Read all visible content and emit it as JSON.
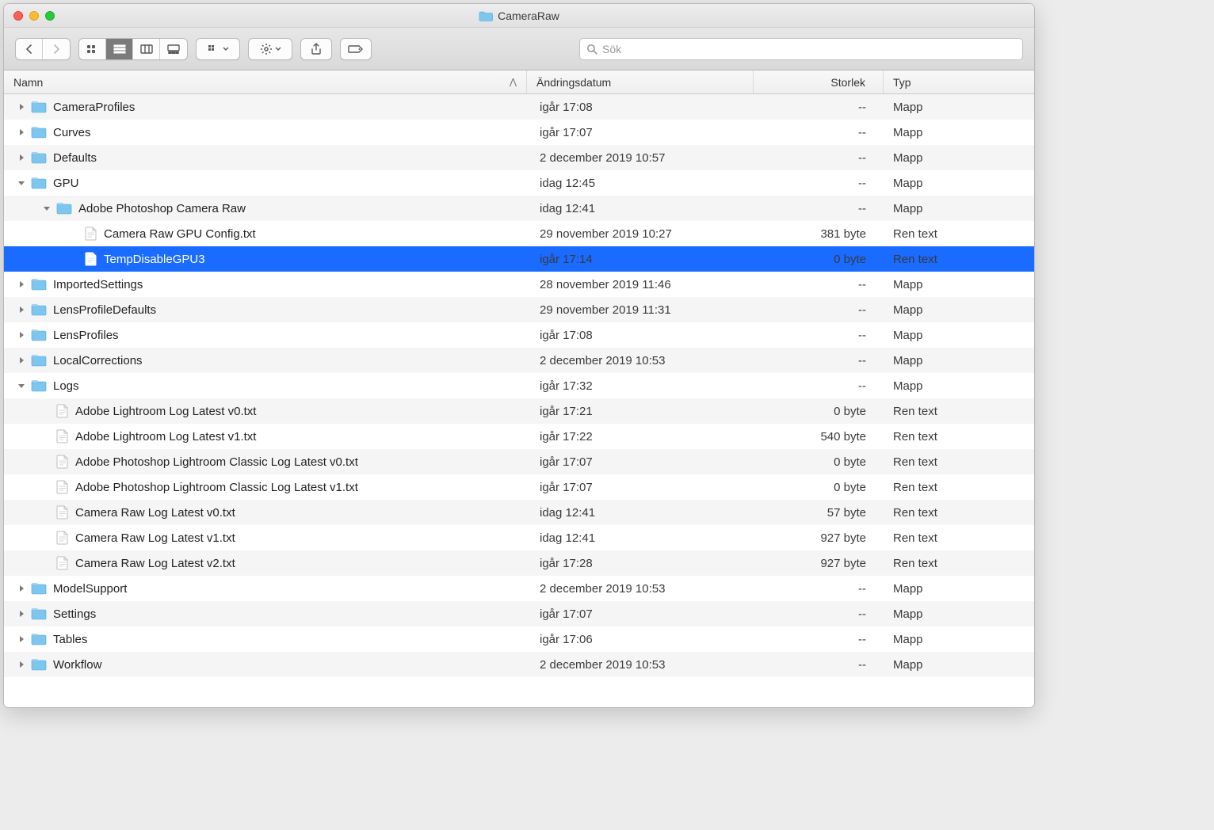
{
  "window": {
    "title": "CameraRaw"
  },
  "search": {
    "placeholder": "Sök"
  },
  "columns": {
    "name": "Namn",
    "date": "Ändringsdatum",
    "size": "Storlek",
    "type": "Typ"
  },
  "rows": [
    {
      "indent": 0,
      "kind": "folder",
      "disclosure": "closed",
      "name": "CameraProfiles",
      "date": "igår 17:08",
      "size": "--",
      "type": "Mapp",
      "alt": true
    },
    {
      "indent": 0,
      "kind": "folder",
      "disclosure": "closed",
      "name": "Curves",
      "date": "igår 17:07",
      "size": "--",
      "type": "Mapp",
      "alt": false
    },
    {
      "indent": 0,
      "kind": "folder",
      "disclosure": "closed",
      "name": "Defaults",
      "date": "2 december 2019 10:57",
      "size": "--",
      "type": "Mapp",
      "alt": true
    },
    {
      "indent": 0,
      "kind": "folder",
      "disclosure": "open",
      "name": "GPU",
      "date": "idag 12:45",
      "size": "--",
      "type": "Mapp",
      "alt": false
    },
    {
      "indent": 1,
      "kind": "folder",
      "disclosure": "open",
      "name": "Adobe Photoshop Camera Raw",
      "date": "idag 12:41",
      "size": "--",
      "type": "Mapp",
      "alt": true
    },
    {
      "indent": 2,
      "kind": "file",
      "disclosure": "none",
      "name": "Camera Raw GPU Config.txt",
      "date": "29 november 2019 10:27",
      "size": "381 byte",
      "type": "Ren text",
      "alt": false
    },
    {
      "indent": 2,
      "kind": "file",
      "disclosure": "none",
      "name": "TempDisableGPU3",
      "date": "igår 17:14",
      "size": "0 byte",
      "type": "Ren text",
      "alt": true,
      "selected": true
    },
    {
      "indent": 0,
      "kind": "folder",
      "disclosure": "closed",
      "name": "ImportedSettings",
      "date": "28 november 2019 11:46",
      "size": "--",
      "type": "Mapp",
      "alt": false
    },
    {
      "indent": 0,
      "kind": "folder",
      "disclosure": "closed",
      "name": "LensProfileDefaults",
      "date": "29 november 2019 11:31",
      "size": "--",
      "type": "Mapp",
      "alt": true
    },
    {
      "indent": 0,
      "kind": "folder",
      "disclosure": "closed",
      "name": "LensProfiles",
      "date": "igår 17:08",
      "size": "--",
      "type": "Mapp",
      "alt": false
    },
    {
      "indent": 0,
      "kind": "folder",
      "disclosure": "closed",
      "name": "LocalCorrections",
      "date": "2 december 2019 10:53",
      "size": "--",
      "type": "Mapp",
      "alt": true
    },
    {
      "indent": 0,
      "kind": "folder",
      "disclosure": "open",
      "name": "Logs",
      "date": "igår 17:32",
      "size": "--",
      "type": "Mapp",
      "alt": false
    },
    {
      "indent": 1,
      "kind": "file",
      "disclosure": "none",
      "name": "Adobe Lightroom Log Latest v0.txt",
      "date": "igår 17:21",
      "size": "0 byte",
      "type": "Ren text",
      "alt": true
    },
    {
      "indent": 1,
      "kind": "file",
      "disclosure": "none",
      "name": "Adobe Lightroom Log Latest v1.txt",
      "date": "igår 17:22",
      "size": "540 byte",
      "type": "Ren text",
      "alt": false
    },
    {
      "indent": 1,
      "kind": "file",
      "disclosure": "none",
      "name": "Adobe Photoshop Lightroom Classic Log Latest v0.txt",
      "date": "igår 17:07",
      "size": "0 byte",
      "type": "Ren text",
      "alt": true
    },
    {
      "indent": 1,
      "kind": "file",
      "disclosure": "none",
      "name": "Adobe Photoshop Lightroom Classic Log Latest v1.txt",
      "date": "igår 17:07",
      "size": "0 byte",
      "type": "Ren text",
      "alt": false
    },
    {
      "indent": 1,
      "kind": "file",
      "disclosure": "none",
      "name": "Camera Raw Log Latest v0.txt",
      "date": "idag 12:41",
      "size": "57 byte",
      "type": "Ren text",
      "alt": true
    },
    {
      "indent": 1,
      "kind": "file",
      "disclosure": "none",
      "name": "Camera Raw Log Latest v1.txt",
      "date": "idag 12:41",
      "size": "927 byte",
      "type": "Ren text",
      "alt": false
    },
    {
      "indent": 1,
      "kind": "file",
      "disclosure": "none",
      "name": "Camera Raw Log Latest v2.txt",
      "date": "igår 17:28",
      "size": "927 byte",
      "type": "Ren text",
      "alt": true
    },
    {
      "indent": 0,
      "kind": "folder",
      "disclosure": "closed",
      "name": "ModelSupport",
      "date": "2 december 2019 10:53",
      "size": "--",
      "type": "Mapp",
      "alt": false
    },
    {
      "indent": 0,
      "kind": "folder",
      "disclosure": "closed",
      "name": "Settings",
      "date": "igår 17:07",
      "size": "--",
      "type": "Mapp",
      "alt": true
    },
    {
      "indent": 0,
      "kind": "folder",
      "disclosure": "closed",
      "name": "Tables",
      "date": "igår 17:06",
      "size": "--",
      "type": "Mapp",
      "alt": false
    },
    {
      "indent": 0,
      "kind": "folder",
      "disclosure": "closed",
      "name": "Workflow",
      "date": "2 december 2019 10:53",
      "size": "--",
      "type": "Mapp",
      "alt": true
    }
  ]
}
